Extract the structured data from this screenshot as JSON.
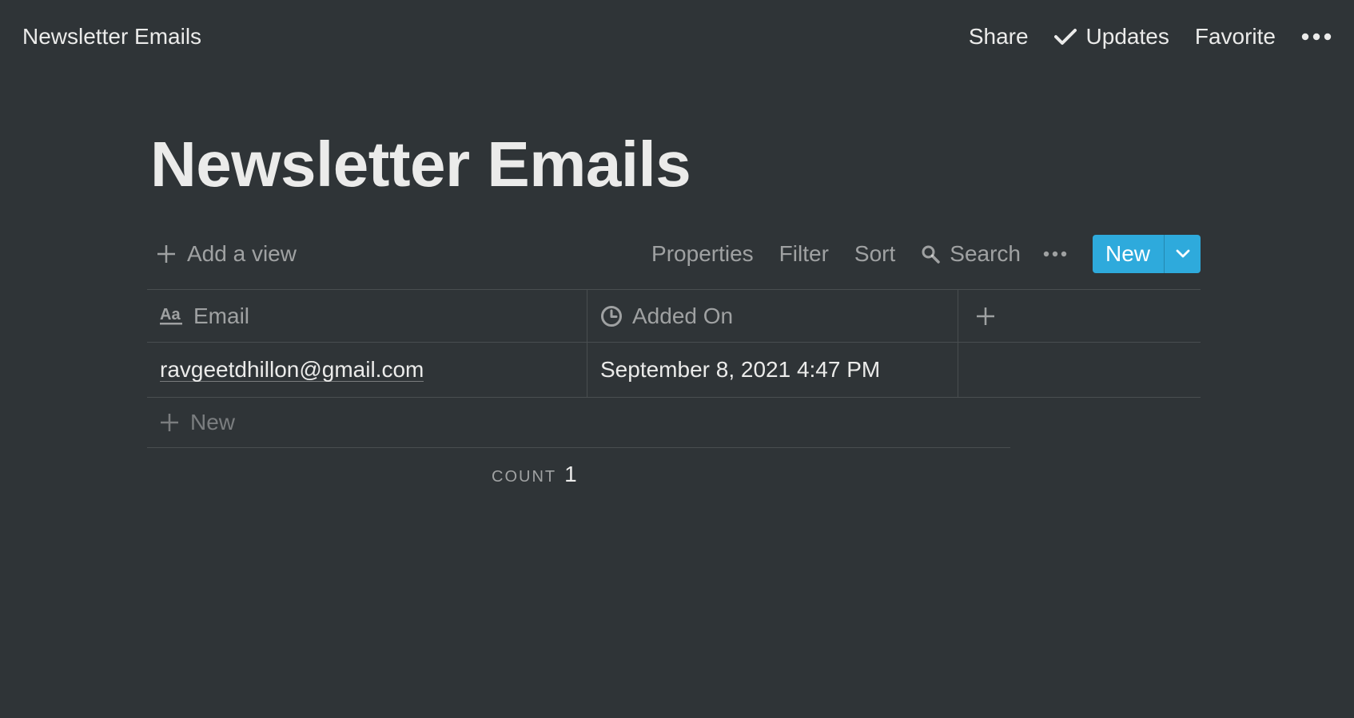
{
  "topbar": {
    "breadcrumb": "Newsletter Emails",
    "share_label": "Share",
    "updates_label": "Updates",
    "favorite_label": "Favorite"
  },
  "page": {
    "title": "Newsletter Emails"
  },
  "view_toolbar": {
    "add_view_label": "Add a view",
    "properties_label": "Properties",
    "filter_label": "Filter",
    "sort_label": "Sort",
    "search_label": "Search",
    "new_button_label": "New"
  },
  "table": {
    "columns": [
      {
        "label": "Email",
        "icon": "text-property-icon"
      },
      {
        "label": "Added On",
        "icon": "clock-icon"
      }
    ],
    "rows": [
      {
        "email": "ravgeetdhillon@gmail.com",
        "added_on": "September 8, 2021 4:47 PM"
      }
    ],
    "new_row_label": "New",
    "count_label": "COUNT",
    "count_value": "1"
  },
  "colors": {
    "background": "#2f3437",
    "accent": "#2eaadc",
    "text": "#ebebea"
  }
}
